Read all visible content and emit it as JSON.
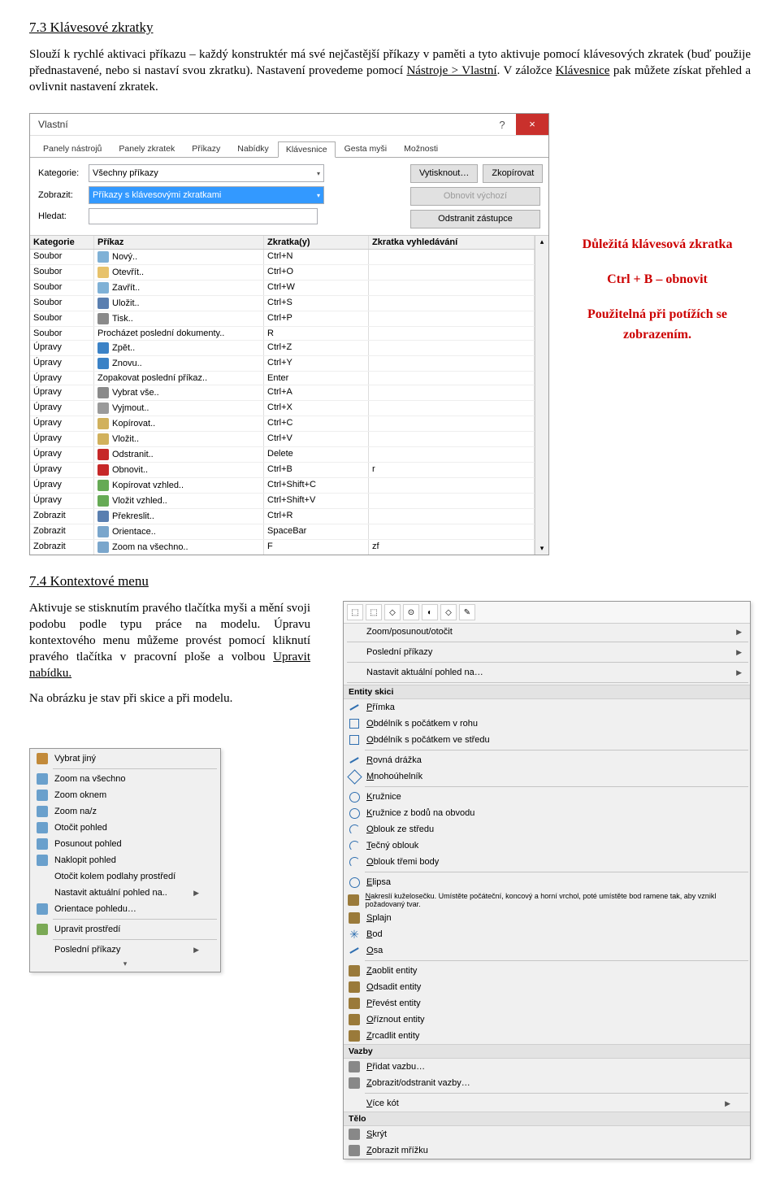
{
  "h1": "7.3  Klávesové zkratky",
  "p1a": "Slouží k rychlé aktivaci příkazu – každý konstruktér má své nejčastější příkazy v paměti a tyto aktivuje pomocí klávesových zkratek (buď použije přednastavené, nebo si nastaví svou zkratku). Nastavení provedeme pomocí ",
  "p1u1": "Nástroje > Vlastní",
  "p1b": ". V záložce ",
  "p1u2": "Klávesnice",
  "p1c": " pak můžete získat přehled a ovlivnit nastavení zkratek.",
  "dialog": {
    "title": "Vlastní",
    "tabs": [
      "Panely nástrojů",
      "Panely zkratek",
      "Příkazy",
      "Nabídky",
      "Klávesnice",
      "Gesta myši",
      "Možnosti"
    ],
    "active_tab": 4,
    "labels": {
      "kat": "Kategorie:",
      "zob": "Zobrazit:",
      "hle": "Hledat:"
    },
    "kat_val": "Všechny příkazy",
    "zob_val": "Příkazy s klávesovými zkratkami",
    "buttons": {
      "print": "Vytisknout…",
      "copy": "Zkopírovat",
      "reset": "Obnovit výchozí",
      "remove": "Odstranit zástupce"
    },
    "cols": {
      "c1": "Kategorie",
      "c2": "Příkaz",
      "c3": "Zkratka(y)",
      "c4": "Zkratka vyhledávání"
    },
    "rows": [
      {
        "cat": "Soubor",
        "cmd": "Nový..",
        "sc": "Ctrl+N",
        "f": "",
        "ic": "#7fb1d6"
      },
      {
        "cat": "Soubor",
        "cmd": "Otevřít..",
        "sc": "Ctrl+O",
        "f": "",
        "ic": "#e7c26b"
      },
      {
        "cat": "Soubor",
        "cmd": "Zavřít..",
        "sc": "Ctrl+W",
        "f": "",
        "ic": "#7fb1d6"
      },
      {
        "cat": "Soubor",
        "cmd": "Uložit..",
        "sc": "Ctrl+S",
        "f": "",
        "ic": "#5a7fb0"
      },
      {
        "cat": "Soubor",
        "cmd": "Tisk..",
        "sc": "Ctrl+P",
        "f": "",
        "ic": "#8a8a8a"
      },
      {
        "cat": "Soubor",
        "cmd": "Procházet poslední dokumenty..",
        "sc": "R",
        "f": "",
        "ic": ""
      },
      {
        "cat": "Úpravy",
        "cmd": "Zpět..",
        "sc": "Ctrl+Z",
        "f": "",
        "ic": "#3b82c6"
      },
      {
        "cat": "Úpravy",
        "cmd": "Znovu..",
        "sc": "Ctrl+Y",
        "f": "",
        "ic": "#3b82c6"
      },
      {
        "cat": "Úpravy",
        "cmd": "Zopakovat poslední příkaz..",
        "sc": "Enter",
        "f": "",
        "ic": ""
      },
      {
        "cat": "Úpravy",
        "cmd": "Vybrat vše..",
        "sc": "Ctrl+A",
        "f": "",
        "ic": "#8a8a8a"
      },
      {
        "cat": "Úpravy",
        "cmd": "Vyjmout..",
        "sc": "Ctrl+X",
        "f": "",
        "ic": "#9a9a9a"
      },
      {
        "cat": "Úpravy",
        "cmd": "Kopírovat..",
        "sc": "Ctrl+C",
        "f": "",
        "ic": "#d1b15c"
      },
      {
        "cat": "Úpravy",
        "cmd": "Vložit..",
        "sc": "Ctrl+V",
        "f": "",
        "ic": "#d1b15c"
      },
      {
        "cat": "Úpravy",
        "cmd": "Odstranit..",
        "sc": "Delete",
        "f": "",
        "ic": "#c62828"
      },
      {
        "cat": "Úpravy",
        "cmd": "Obnovit..",
        "sc": "Ctrl+B",
        "f": "r",
        "ic": "#c62828"
      },
      {
        "cat": "Úpravy",
        "cmd": "Kopírovat vzhled..",
        "sc": "Ctrl+Shift+C",
        "f": "",
        "ic": "#66aa55"
      },
      {
        "cat": "Úpravy",
        "cmd": "Vložit vzhled..",
        "sc": "Ctrl+Shift+V",
        "f": "",
        "ic": "#66aa55"
      },
      {
        "cat": "Zobrazit",
        "cmd": "Překreslit..",
        "sc": "Ctrl+R",
        "f": "",
        "ic": "#5a7fb0"
      },
      {
        "cat": "Zobrazit",
        "cmd": "Orientace..",
        "sc": "SpaceBar",
        "f": "",
        "ic": "#7aa6cc"
      },
      {
        "cat": "Zobrazit",
        "cmd": "Zoom na všechno..",
        "sc": "F",
        "f": "zf",
        "ic": "#7aa6cc"
      }
    ]
  },
  "note": {
    "l1": "Důležitá klávesová zkratka",
    "l2": "Ctrl + B – obnovit",
    "l3": "Použitelná při potížích se zobrazením."
  },
  "h2": "7.4  Kontextové menu",
  "p2a": "Aktivuje se stisknutím pravého tlačítka myši a mění svoji podobu podle typu práce na modelu. Úpravu kontextového menu můžeme provést pomocí kliknutí pravého tlačítka v pracovní ploše a volbou ",
  "p2u": "Upravit nabídku.",
  "p3": "Na obrázku je stav při skice a při modelu.",
  "menu1": {
    "items": [
      {
        "ic": "#c28a3a",
        "t": "Vybrat jiný"
      },
      {
        "sep": true
      },
      {
        "ic": "#6aa0cc",
        "t": "Zoom na všechno"
      },
      {
        "ic": "#6aa0cc",
        "t": "Zoom oknem"
      },
      {
        "ic": "#6aa0cc",
        "t": "Zoom na/z"
      },
      {
        "ic": "#6aa0cc",
        "t": "Otočit pohled"
      },
      {
        "ic": "#6aa0cc",
        "t": "Posunout pohled"
      },
      {
        "ic": "#6aa0cc",
        "t": "Naklopit pohled"
      },
      {
        "ic": "",
        "t": "Otočit kolem podlahy prostředí"
      },
      {
        "ic": "",
        "t": "Nastavit aktuální pohled na..",
        "sub": true
      },
      {
        "ic": "#6aa0cc",
        "t": "Orientace pohledu…"
      },
      {
        "sep": true
      },
      {
        "ic": "#7aa955",
        "t": "Upravit prostředí"
      },
      {
        "sep": true
      },
      {
        "ic": "",
        "t": "Poslední příkazy",
        "sub": true
      }
    ],
    "expand": "▾"
  },
  "menu2": {
    "tb_icons": [
      "⬚",
      "⬚",
      "◇",
      "⊙",
      "◐",
      "◇",
      "✎"
    ],
    "top": [
      {
        "t": "Zoom/posunout/otočit",
        "sub": true
      },
      {
        "t": "Poslední příkazy",
        "sub": true
      },
      {
        "t": "Nastavit aktuální pohled na…",
        "sub": true
      }
    ],
    "groups": [
      {
        "h": "Entity skici",
        "items": [
          {
            "ic": "line",
            "c": "#2f6fb0",
            "t": "Přímka"
          },
          {
            "ic": "sq",
            "c": "#2f6fb0",
            "t": "Obdélník s počátkem v rohu"
          },
          {
            "ic": "sq",
            "c": "#2f6fb0",
            "t": "Obdélník s počátkem ve středu"
          },
          {
            "sep": true
          },
          {
            "ic": "line",
            "c": "#2f6fb0",
            "t": "Rovná drážka"
          },
          {
            "ic": "poly",
            "c": "#2f6fb0",
            "t": "Mnohoúhelník"
          },
          {
            "sep": true
          },
          {
            "ic": "cir",
            "c": "#2f6fb0",
            "t": "Kružnice"
          },
          {
            "ic": "cir",
            "c": "#2f6fb0",
            "t": "Kružnice z bodů na obvodu"
          },
          {
            "ic": "arc",
            "c": "#2f6fb0",
            "t": "Oblouk ze středu"
          },
          {
            "ic": "arc",
            "c": "#2f6fb0",
            "t": "Tečný oblouk"
          },
          {
            "ic": "arc",
            "c": "#2f6fb0",
            "t": "Oblouk třemi body"
          },
          {
            "sep": true
          },
          {
            "ic": "ell",
            "c": "#2f6fb0",
            "t": "Elipsa"
          },
          {
            "ic": "spl",
            "c": "#9a7a3a",
            "t": "Nakreslí kuželosečku. Umístěte počáteční, koncový a horní vrchol, poté umístěte bod ramene tak, aby vznikl požadovaný tvar.",
            "small": true
          },
          {
            "ic": "spl",
            "c": "#9a7a3a",
            "t": "Splajn"
          },
          {
            "ic": "dot",
            "c": "#2f6fb0",
            "t": "Bod"
          },
          {
            "ic": "line",
            "c": "#2f6fb0",
            "t": "Osa"
          },
          {
            "sep": true
          },
          {
            "ic": "fil",
            "c": "#9a7a3a",
            "t": "Zaoblit entity"
          },
          {
            "ic": "off",
            "c": "#9a7a3a",
            "t": "Odsadit entity"
          },
          {
            "ic": "cnv",
            "c": "#9a7a3a",
            "t": "Převést entity"
          },
          {
            "ic": "tri",
            "c": "#9a7a3a",
            "t": "Oříznout entity"
          },
          {
            "ic": "mir",
            "c": "#9a7a3a",
            "t": "Zrcadlit entity"
          }
        ]
      },
      {
        "h": "Vazby",
        "items": [
          {
            "ic": "rel",
            "c": "#888",
            "t": "Přidat vazbu…"
          },
          {
            "ic": "rel",
            "c": "#888",
            "t": "Zobrazit/odstranit vazby…"
          },
          {
            "sep": true
          },
          {
            "ic": "",
            "c": "",
            "t": "Více kót",
            "sub": true
          }
        ]
      },
      {
        "h": "Tělo",
        "items": [
          {
            "ic": "hid",
            "c": "#888",
            "t": "Skrýt"
          },
          {
            "ic": "grd",
            "c": "#888",
            "t": "Zobrazit mřížku"
          }
        ]
      }
    ]
  }
}
